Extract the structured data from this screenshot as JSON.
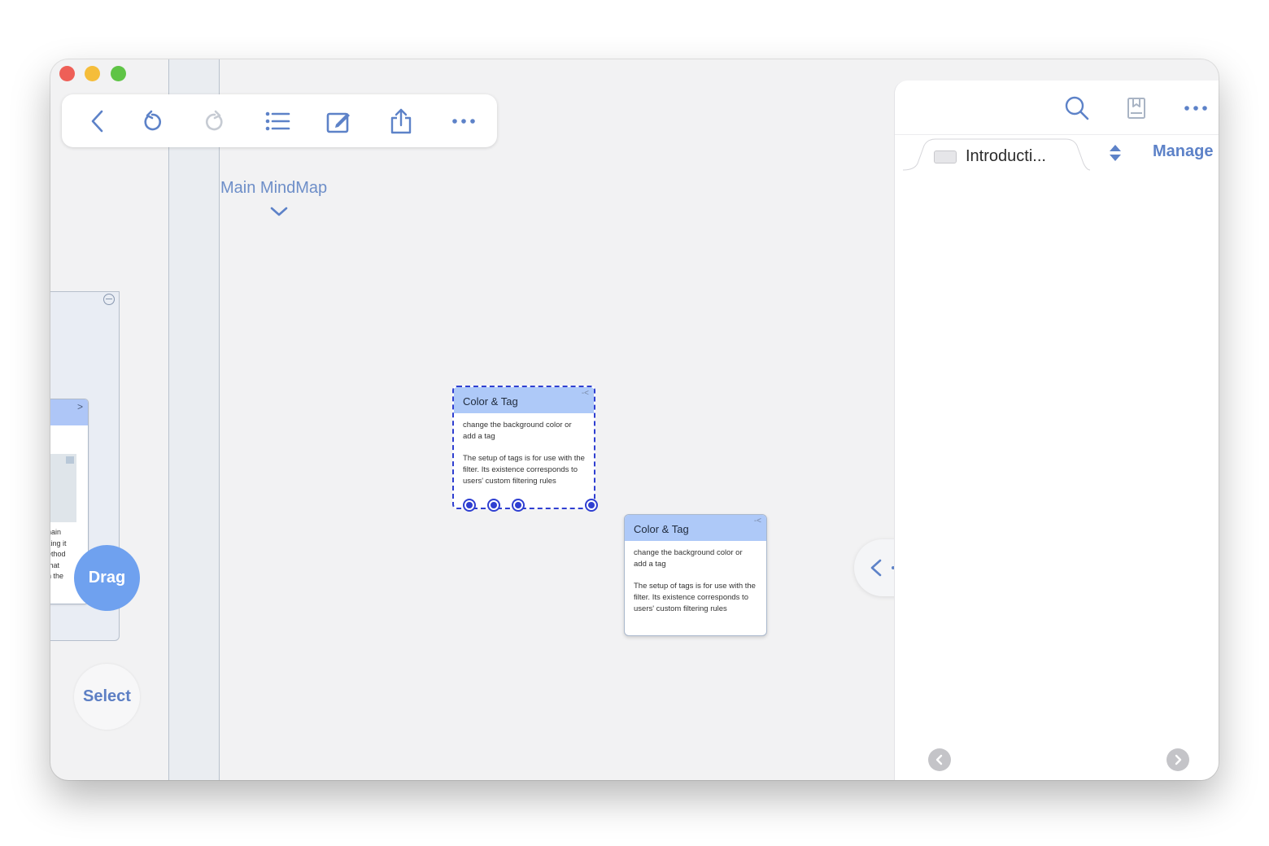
{
  "window": {
    "controls": [
      "close",
      "minimize",
      "zoom"
    ]
  },
  "toolbar": {
    "icons": [
      "back-icon",
      "undo-icon",
      "redo-icon",
      "outline-list-icon",
      "edit-icon",
      "share-icon",
      "more-icon"
    ]
  },
  "map": {
    "title": "Main MindMap"
  },
  "left_panel": {
    "mini_card_text": "nain\nking it\nethod\nthat\nn the"
  },
  "buttons": {
    "drag": "Drag",
    "select": "Select"
  },
  "nodes": [
    {
      "title": "Color & Tag",
      "line1": "change the background color or add a tag",
      "line2": "The setup of tags is for use with the filter. Its existence corresponds to users' custom filtering rules",
      "selected": true
    },
    {
      "title": "Color & Tag",
      "line1": "change the background color or add a tag",
      "line2": "The setup of tags is for use with the filter. Its existence corresponds to users' custom filtering rules",
      "selected": false
    }
  ],
  "right_panel": {
    "tab_label": "Introducti...",
    "manage": "Manage",
    "icons": [
      "search-icon",
      "bookmark-icon",
      "more-icon"
    ]
  },
  "colors": {
    "accent": "#5d82c8",
    "node_header": "#aec9f8",
    "selection": "#2f3fd1",
    "drag_button": "#6fa1ef"
  }
}
